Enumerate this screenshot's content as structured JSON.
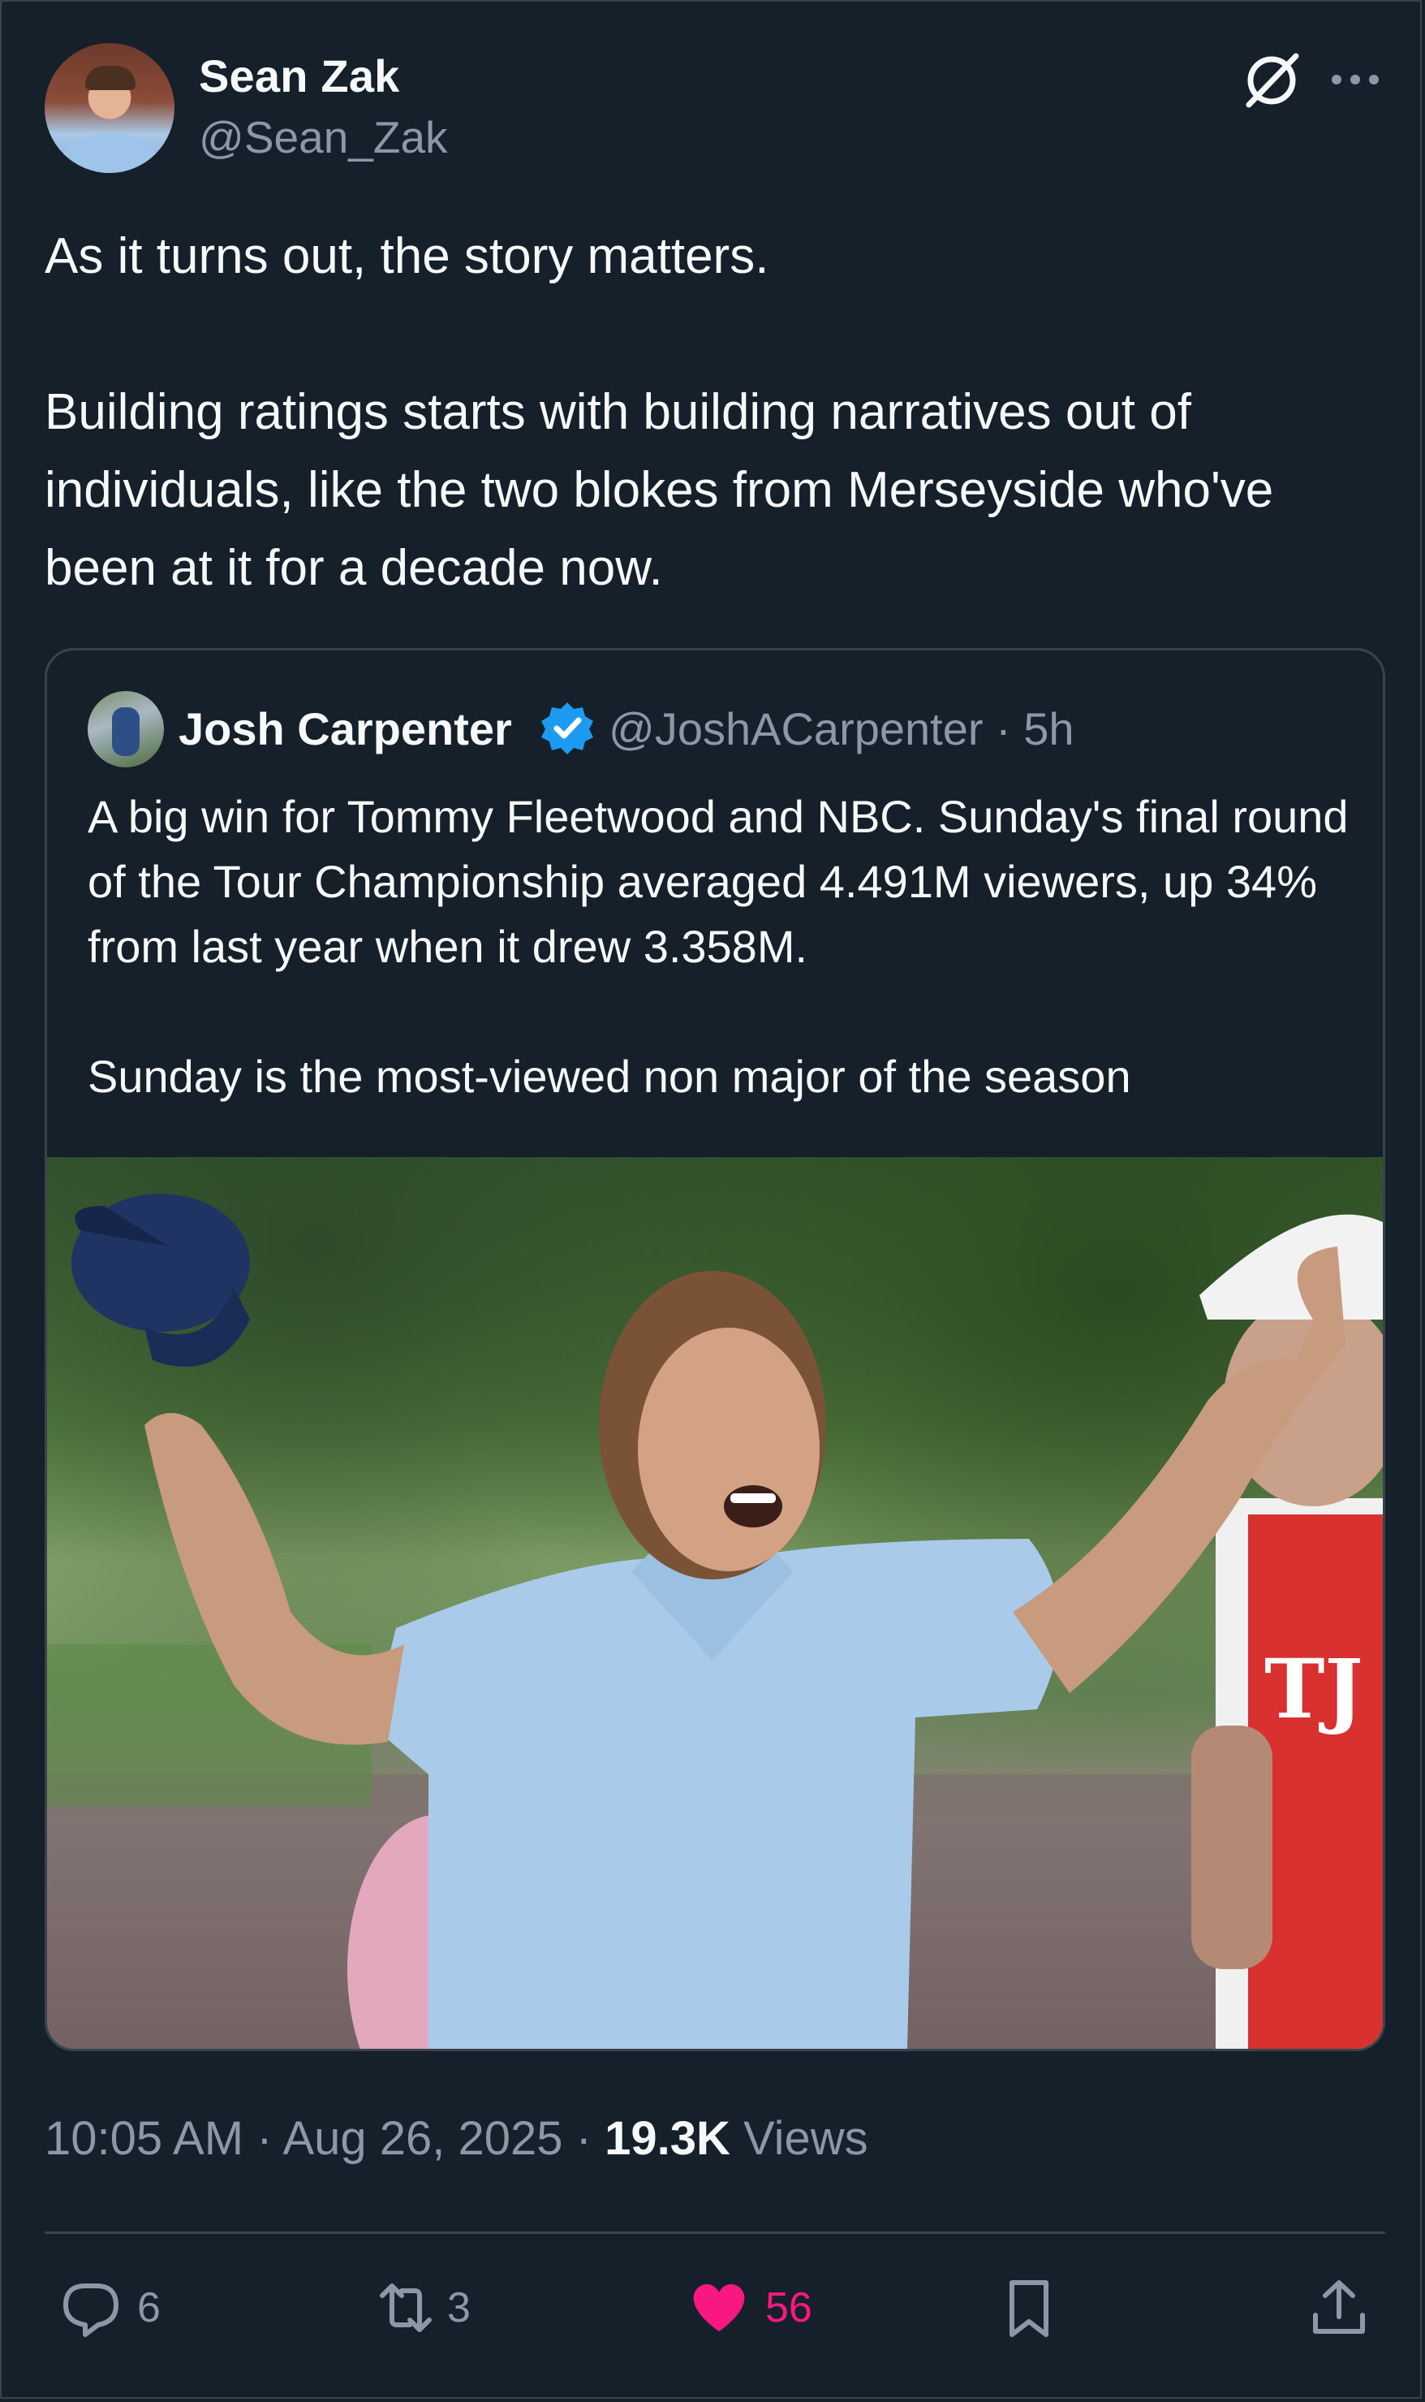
{
  "author": {
    "name": "Sean Zak",
    "handle": "@Sean_Zak"
  },
  "tweet": {
    "text": "As it turns out, the story matters.\n\nBuilding ratings starts with building narratives out of individuals, like the two blokes from Merseyside who've been at it for a decade now."
  },
  "quoted": {
    "name": "Josh Carpenter",
    "handle_time": "@JoshACarpenter · 5h",
    "text": "A big win for Tommy Fleetwood and NBC. Sunday's final round of the Tour Championship averaged 4.491M viewers, up 34% from last year when it drew 3.358M.\n\nSunday is the most-viewed non major of the season",
    "image_alt": "Golfer celebrating with arms raised, holding a cap"
  },
  "meta": {
    "time": "10:05 AM",
    "date": "Aug 26, 2025",
    "views_count": "19.3K",
    "views_label": "Views",
    "separator": "·"
  },
  "actions": {
    "replies": "6",
    "reposts": "3",
    "likes": "56"
  },
  "colors": {
    "background": "#15202b",
    "border": "#38444d",
    "muted": "#8b98a5",
    "like": "#f91880",
    "verified": "#1d9bf0"
  },
  "icons": [
    "grok-icon",
    "more-icon",
    "verified-icon",
    "reply-icon",
    "repost-icon",
    "like-icon",
    "bookmark-icon",
    "share-icon"
  ]
}
